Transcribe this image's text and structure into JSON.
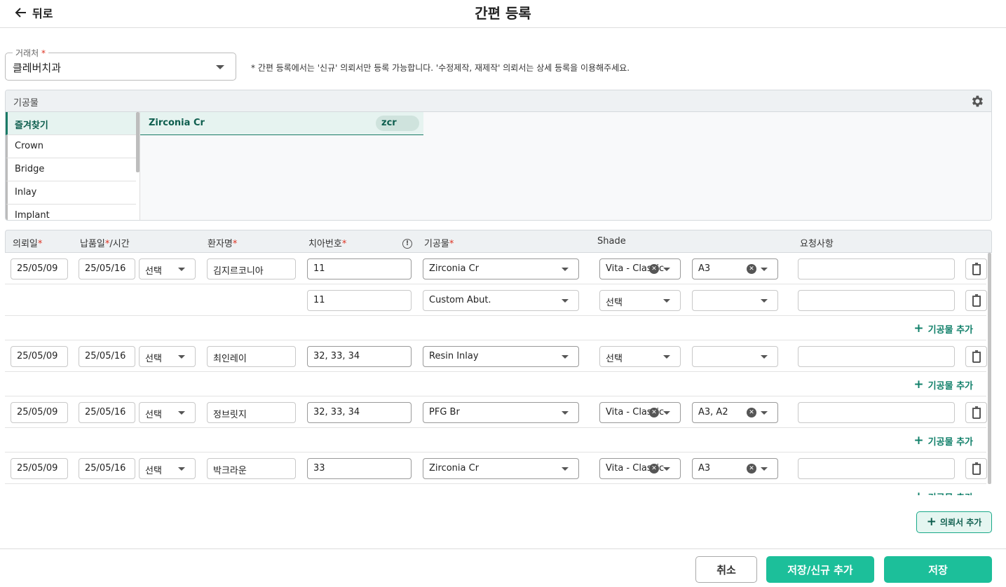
{
  "header": {
    "back_label": "뒤로",
    "title": "간편 등록"
  },
  "client": {
    "label": "거래처",
    "required": "*",
    "value": "클레버치과"
  },
  "notice": "* 간편 등록에서는 '신규' 의뢰서만 등록 가능합니다. '수정제작, 재제작' 의뢰서는 상세 등록을 이용해주세요.",
  "panel": {
    "title": "기공물",
    "categories": [
      "즐겨찾기",
      "Crown",
      "Bridge",
      "Inlay",
      "Implant"
    ],
    "items": [
      {
        "name": "Zirconia Cr",
        "code": "zcr"
      }
    ]
  },
  "table": {
    "headers": {
      "request_date": "의뢰일",
      "delivery_a": "납품일",
      "delivery_b": "/시간",
      "patient": "환자명",
      "tooth": "치아번호",
      "product": "기공물",
      "shade": "Shade",
      "request": "요청사항",
      "req": "*"
    },
    "add_product_label": "기공물 추가",
    "rows": [
      {
        "date": "25/05/09",
        "delivery": "25/05/16",
        "time": "선택",
        "patient": "김지르코니아",
        "tooth": "11",
        "product": "Zirconia Cr",
        "shade_system": "Vita - Classic",
        "shade": "A3",
        "request": ""
      },
      {
        "date": "",
        "delivery": "",
        "time": "",
        "patient": "",
        "tooth": "11",
        "product": "Custom Abut.",
        "shade_system": "선택",
        "shade": "",
        "request": ""
      },
      {
        "date": "25/05/09",
        "delivery": "25/05/16",
        "time": "선택",
        "patient": "최인레이",
        "tooth": "32, 33, 34",
        "product": "Resin Inlay",
        "shade_system": "선택",
        "shade": "",
        "request": ""
      },
      {
        "date": "25/05/09",
        "delivery": "25/05/16",
        "time": "선택",
        "patient": "정브릿지",
        "tooth": "32, 33, 34",
        "product": "PFG Br",
        "shade_system": "Vita - Classic",
        "shade": "A3, A2",
        "request": ""
      },
      {
        "date": "25/05/09",
        "delivery": "25/05/16",
        "time": "선택",
        "patient": "박크라운",
        "tooth": "33",
        "product": "Zirconia Cr",
        "shade_system": "Vita - Classic",
        "shade": "A3",
        "request": ""
      }
    ]
  },
  "add_request_label": "의뢰서 추가",
  "footer": {
    "cancel": "취소",
    "save_new": "저장/신규 추가",
    "save": "저장"
  },
  "colors": {
    "accent": "#1cbf9a",
    "accent_dark": "#11806a"
  }
}
